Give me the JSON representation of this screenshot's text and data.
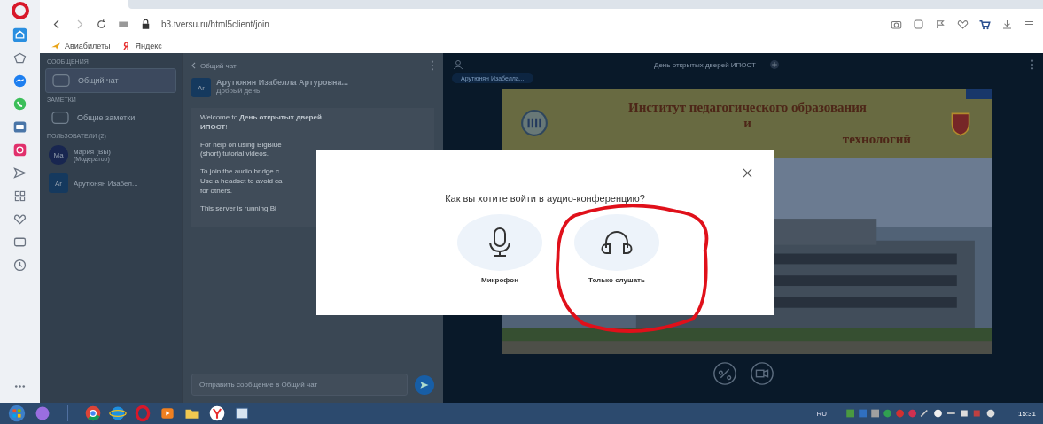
{
  "browser": {
    "url": "b3.tversu.ru/html5client/join",
    "bookmarks": [
      {
        "label": "Авиабилеты",
        "kind": "plane"
      },
      {
        "label": "Яндекс",
        "kind": "yandex"
      }
    ]
  },
  "user_panel": {
    "sections": [
      {
        "title": "СООБЩЕНИЯ",
        "items": [
          {
            "label": "Общий чат",
            "selected": true
          }
        ]
      },
      {
        "title": "ЗАМЕТКИ",
        "items": [
          {
            "label": "Общие заметки",
            "selected": false
          }
        ]
      }
    ],
    "users_title": "ПОЛЬЗОВАТЕЛИ (2)",
    "users": [
      {
        "initials": "Ма",
        "name": "мария (Вы)",
        "role": "(Модератор)"
      },
      {
        "initials": "Ar",
        "name": "Арутюнян Изабел..."
      }
    ]
  },
  "chat": {
    "title": "Общий чат",
    "message": {
      "initials": "Ar",
      "author": "Арутюнян Изабелла Артуровна...",
      "text": "Добрый день!"
    },
    "welcome": [
      {
        "lines": [
          "Welcome to **День открытых дверей**",
          "**ИПОСТ**!"
        ]
      },
      {
        "lines": [
          "For help on using BigBlue",
          "(short) tutorial videos."
        ]
      },
      {
        "lines": [
          "To join the audio bridge c",
          "Use a headset to avoid ca",
          "for others."
        ]
      },
      {
        "lines": [
          "This server is running Bi"
        ]
      }
    ],
    "input_placeholder": "Отправить сообщение в Общий чат"
  },
  "presentation": {
    "title": "День открытых дверей ИПОСТ",
    "talker": "Арутюнян Изабелла...",
    "slide_lines": [
      "Институт педагогического образования",
      "и",
      "технологий"
    ]
  },
  "modal": {
    "question": "Как вы хотите войти в аудио-конференцию?",
    "options": [
      {
        "label": "Микрофон",
        "kind": "microphone",
        "annotated": false
      },
      {
        "label": "Только слушать",
        "kind": "headphones",
        "annotated": true
      }
    ]
  },
  "taskbar": {
    "language": "RU",
    "time": "15:31"
  }
}
